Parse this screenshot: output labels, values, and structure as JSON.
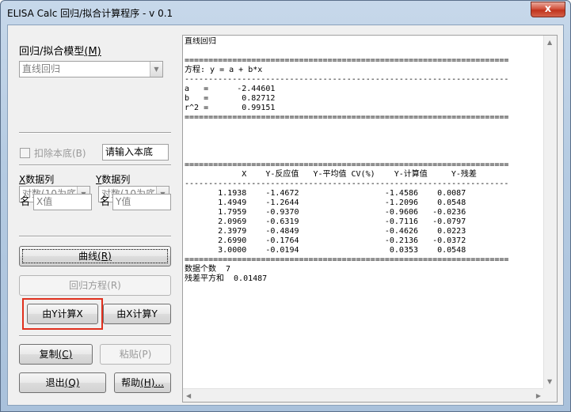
{
  "window": {
    "title": "ELISA Calc 回归/拟合计算程序 - v 0.1",
    "close_glyph": "x"
  },
  "left": {
    "model_label_prefix": "回归/拟合模型",
    "model_label_key": "(M)",
    "model_select_value": "直线回归",
    "subtract_blank_label": "扣除本底(B)",
    "blank_input_placeholder": "请输入本底",
    "x_col_label_key": "X",
    "x_col_label_rest": "数据列",
    "y_col_label_key": "Y",
    "y_col_label_rest": "数据列",
    "x_transform_value": "对数(10为底",
    "y_transform_value": "对数(10为底",
    "x_name_label": "名",
    "x_name_value": "X值",
    "y_name_label": "名",
    "y_name_value": "Y值",
    "curve_button_prefix": "曲线",
    "curve_button_key": "(R)",
    "regression_button": "回归方程(R)",
    "calc_x_from_y_button": "由Y计算X",
    "calc_y_from_x_button": "由X计算Y",
    "copy_button_prefix": "复制",
    "copy_button_key": "(C)",
    "paste_button": "粘贴(P)",
    "exit_button_prefix": "退出",
    "exit_button_key": "(Q)",
    "help_button_prefix": "帮助",
    "help_button_key": "(H)..."
  },
  "output": {
    "text": "直线回归\n\n====================================================================\n方程: y = a + b*x\n--------------------------------------------------------------------\na   =      -2.44601\nb   =       0.82712\nr^2 =       0.99151\n====================================================================\n\n\n\n\n====================================================================\n            X    Y-反应值   Y-平均值 CV(%)    Y-计算值     Y-残差\n--------------------------------------------------------------------\n       1.1938    -1.4672                  -1.4586    0.0087\n       1.4949    -1.2644                  -1.2096    0.0548\n       1.7959    -0.9370                  -0.9606   -0.0236\n       2.0969    -0.6319                  -0.7116   -0.0797\n       2.3979    -0.4849                  -0.4626    0.0223\n       2.6990    -0.1764                  -0.2136   -0.0372\n       3.0000    -0.0194                   0.0353    0.0548\n====================================================================\n数据个数  7\n残差平方和  0.01487"
  },
  "icons": {
    "scroll_up": "▲",
    "scroll_down": "▼",
    "scroll_left": "◀",
    "scroll_right": "▶",
    "dropdown": "▼"
  }
}
